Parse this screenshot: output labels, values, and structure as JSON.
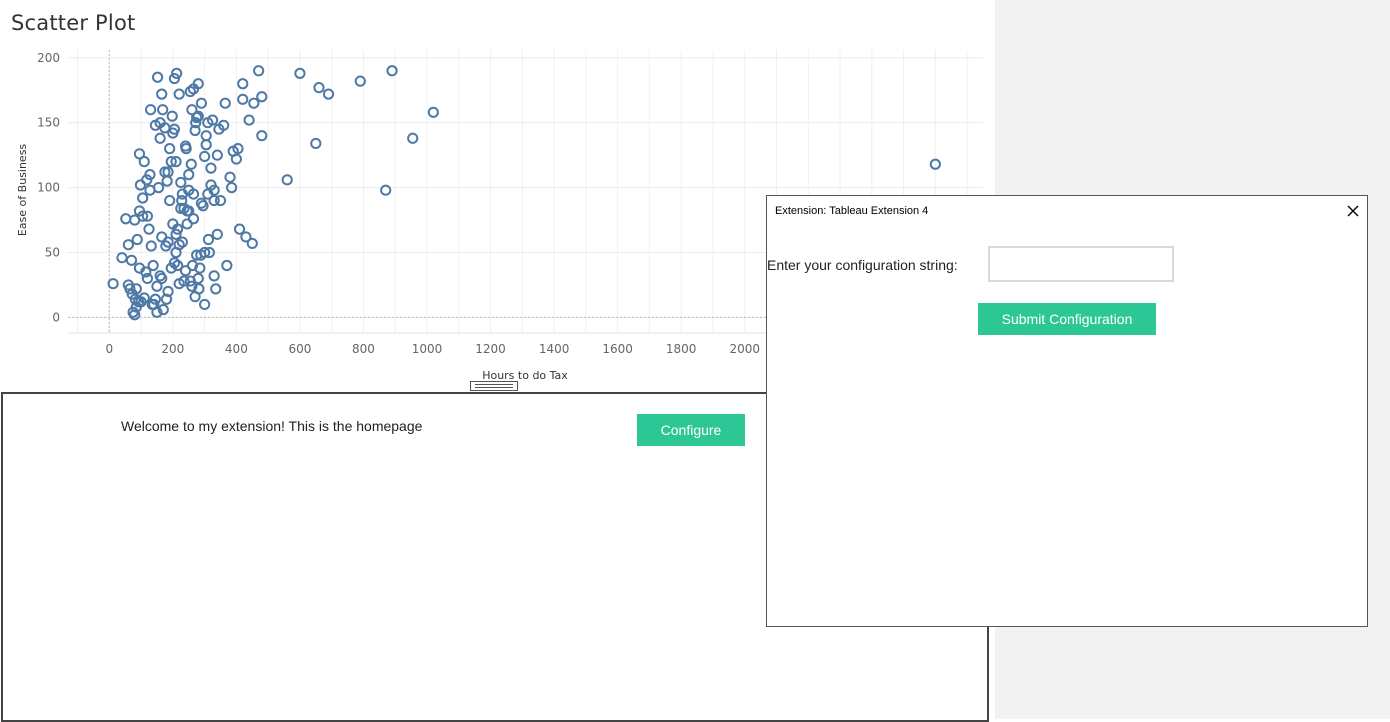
{
  "worksheet": {
    "title": "Scatter Plot"
  },
  "chart_data": {
    "type": "scatter",
    "title": "Scatter Plot",
    "xlabel": "Hours to do Tax",
    "ylabel": "Ease of Business",
    "xlim": [
      -130,
      2750
    ],
    "ylim": [
      -12,
      206
    ],
    "x_ticks": [
      0,
      200,
      400,
      600,
      800,
      1000,
      1200,
      1400,
      1600,
      1800,
      2000
    ],
    "y_ticks": [
      0,
      50,
      100,
      150,
      200
    ],
    "grid": true,
    "marker": "hollow-circle",
    "color": "#4e79a7",
    "series": [
      {
        "x": [
          12,
          40,
          52,
          60,
          65,
          72,
          75,
          80,
          82,
          85,
          88,
          92,
          98,
          105,
          110,
          115,
          120,
          128,
          132,
          138,
          145,
          152,
          160,
          168,
          175,
          182,
          190,
          198,
          205,
          212,
          220,
          228,
          235,
          242,
          250,
          258,
          265,
          272,
          280,
          288,
          295,
          305,
          312,
          320,
          330,
          340,
          350,
          360,
          370,
          380,
          390,
          400,
          410,
          420,
          430,
          440,
          450,
          470,
          480,
          560,
          600,
          650,
          660,
          690,
          790,
          870,
          890,
          955,
          1020,
          2600,
          60,
          70,
          85,
          95,
          110,
          125,
          135,
          150,
          160,
          170,
          185,
          195,
          210,
          220,
          230,
          245,
          255,
          265,
          275,
          285,
          300,
          310,
          320,
          330,
          340,
          155,
          175,
          200,
          215,
          240,
          260,
          280,
          290,
          305,
          325,
          345,
          365,
          385,
          405,
          420,
          455,
          480,
          80,
          95,
          105,
          118,
          128,
          140,
          150,
          165,
          178,
          190,
          200,
          210,
          225,
          235,
          250,
          262,
          270,
          282,
          300,
          315,
          330,
          95,
          120,
          145,
          165,
          185,
          205,
          225,
          245,
          265,
          290,
          310,
          335,
          100,
          130,
          160,
          185,
          210,
          230,
          255,
          270,
          195,
          215,
          240,
          260,
          280,
          165,
          180,
          205,
          220,
          250,
          275,
          300
        ],
        "y": [
          26,
          46,
          76,
          25,
          22,
          18,
          4,
          2,
          14,
          8,
          60,
          12,
          102,
          92,
          120,
          35,
          78,
          110,
          55,
          40,
          148,
          185,
          138,
          160,
          146,
          105,
          130,
          155,
          184,
          188,
          172,
          90,
          84,
          130,
          82,
          118,
          176,
          150,
          180,
          48,
          86,
          140,
          60,
          115,
          98,
          125,
          90,
          148,
          40,
          108,
          128,
          122,
          68,
          168,
          62,
          152,
          57,
          190,
          140,
          106,
          188,
          134,
          177,
          172,
          182,
          98,
          190,
          138,
          158,
          118,
          56,
          44,
          22,
          38,
          15,
          68,
          10,
          24,
          32,
          6,
          20,
          120,
          64,
          26,
          95,
          82,
          28,
          76,
          48,
          38,
          124,
          95,
          102,
          90,
          64,
          100,
          112,
          142,
          68,
          132,
          160,
          155,
          165,
          133,
          152,
          145,
          165,
          100,
          130,
          180,
          165,
          170,
          75,
          82,
          78,
          106,
          98,
          10,
          4,
          30,
          55,
          90,
          72,
          50,
          104,
          28,
          110,
          40,
          16,
          22,
          50,
          50,
          32,
          126,
          30,
          14,
          62,
          58,
          145,
          84,
          72,
          95,
          88,
          150,
          22,
          12,
          160,
          150,
          112,
          120,
          58,
          174,
          144,
          38,
          40,
          36,
          24,
          30,
          172,
          14,
          42,
          56,
          98,
          154,
          10
        ]
      }
    ]
  },
  "extension": {
    "welcome_text": "Welcome to my extension! This is the homepage",
    "configure_label": "Configure"
  },
  "dialog": {
    "title": "Extension: Tableau Extension 4",
    "close_icon": "close-x-icon",
    "config_label": "Enter your configuration string:",
    "config_value": "",
    "submit_label": "Submit Configuration"
  },
  "colors": {
    "accent": "#2dc795",
    "point": "#4e79a7",
    "right_pane": "#f2f2f2"
  }
}
